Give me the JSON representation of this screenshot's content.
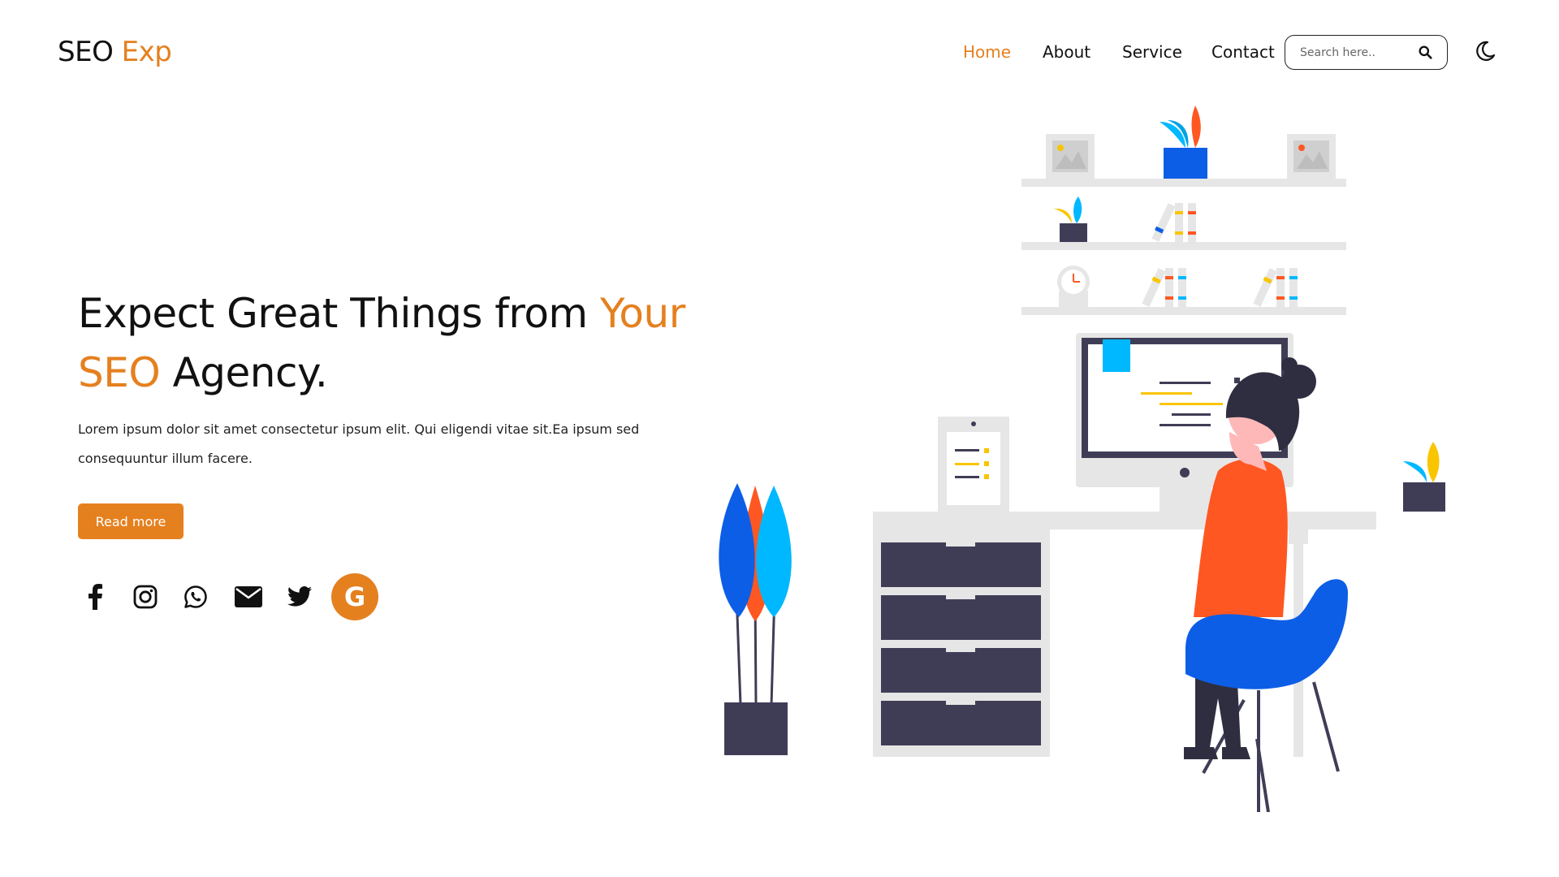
{
  "brand": {
    "name_part1": "SEO",
    "name_part2": "Exp"
  },
  "nav": {
    "items": [
      {
        "label": "Home",
        "active": true
      },
      {
        "label": "About",
        "active": false
      },
      {
        "label": "Service",
        "active": false
      },
      {
        "label": "Contact",
        "active": false
      }
    ]
  },
  "search": {
    "placeholder": "Search here.."
  },
  "hero": {
    "title_part1": "Expect Great Things from ",
    "title_accent1": "Your",
    "title_accent2": "SEO",
    "title_part2": " Agency.",
    "description": "Lorem ipsum dolor sit amet consectetur ipsum elit. Qui eligendi vitae sit.Ea ipsum sed consequuntur illum facere.",
    "button_label": "Read more"
  },
  "socials": {
    "icons": [
      "facebook-icon",
      "instagram-icon",
      "whatsapp-icon",
      "envelope-icon",
      "twitter-icon",
      "google-icon"
    ],
    "google_letter": "G"
  },
  "colors": {
    "accent": "#e5801f",
    "dark": "#3f3d56",
    "blue": "#0d5ee6",
    "sky": "#00b8ff",
    "red": "#ff5722"
  }
}
